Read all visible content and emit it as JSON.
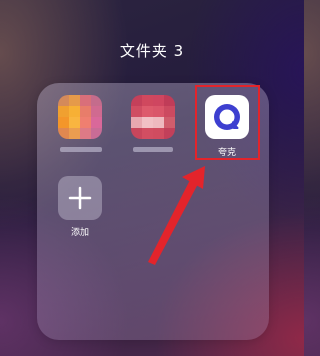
{
  "folder": {
    "title": "文件夹 3"
  },
  "apps": [
    {
      "name": "blurred-app-1",
      "label": ""
    },
    {
      "name": "blurred-app-2",
      "label": ""
    },
    {
      "name": "quark",
      "label": "夸克",
      "icon": "quark-logo-icon"
    },
    {
      "name": "add",
      "label": "添加",
      "icon": "plus-icon"
    }
  ],
  "colors": {
    "highlight": "#e3242b",
    "quark_logo": "#3d3fd0"
  }
}
